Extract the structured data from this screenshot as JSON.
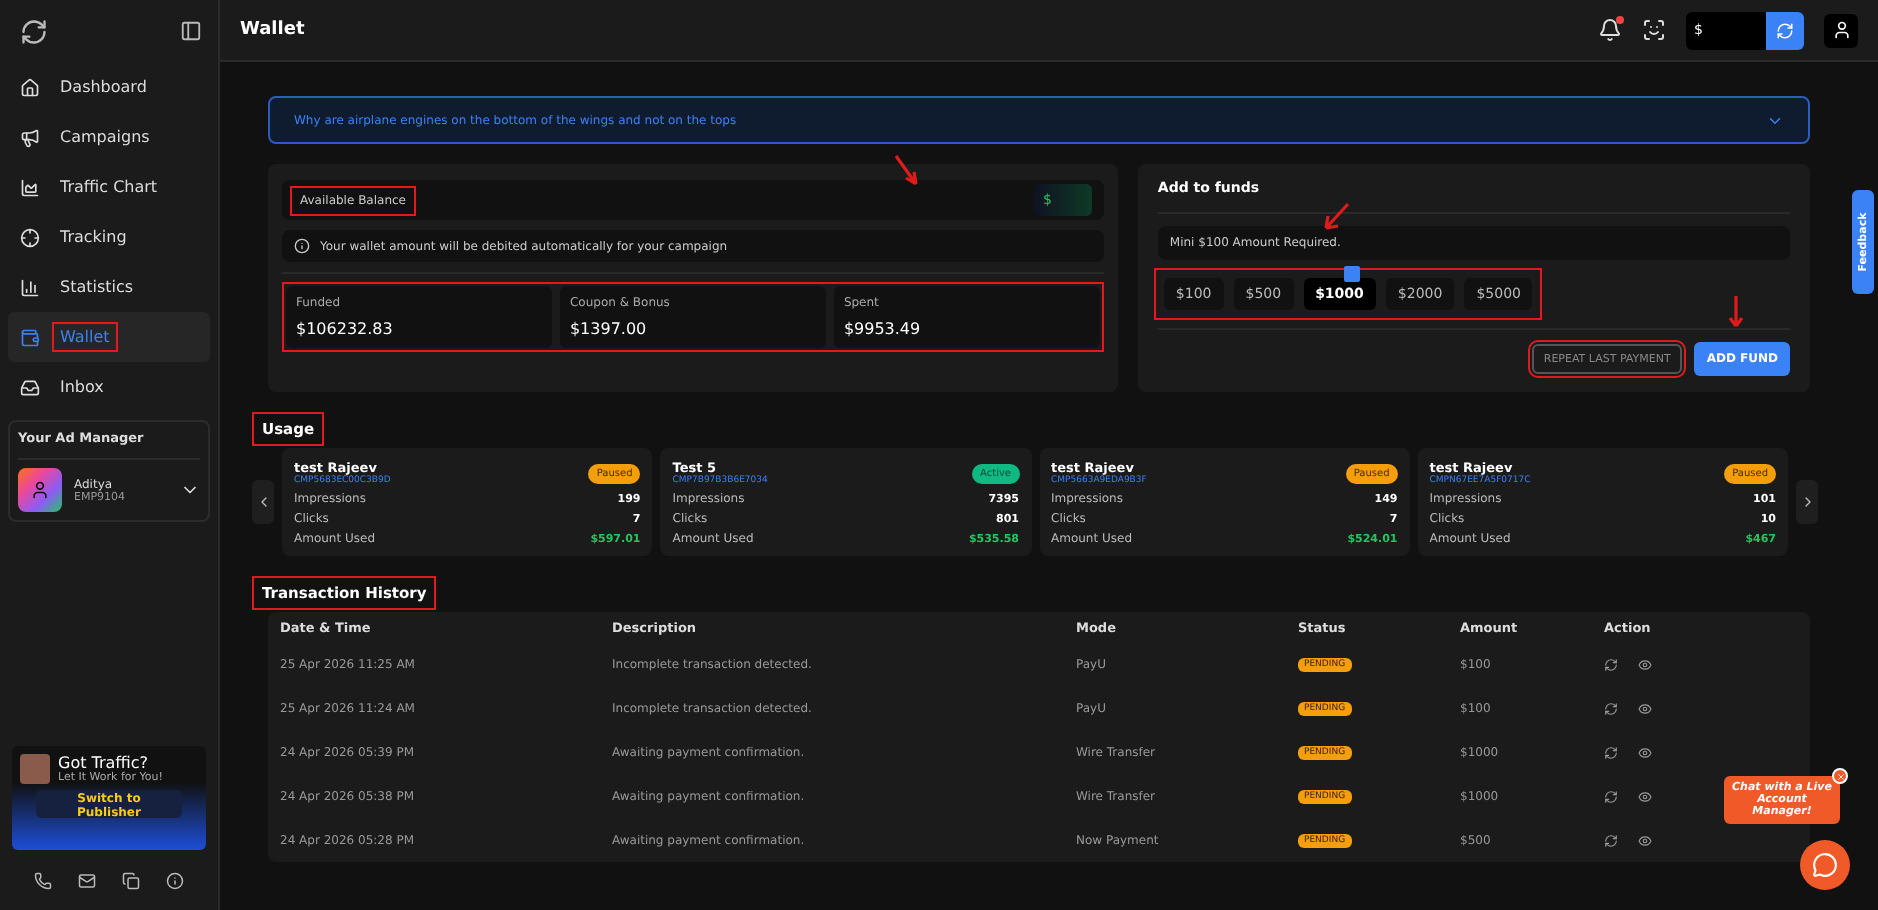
{
  "sidebar": {
    "items": [
      {
        "label": "Dashboard",
        "selected": false
      },
      {
        "label": "Campaigns",
        "selected": false
      },
      {
        "label": "Traffic Chart",
        "selected": false
      },
      {
        "label": "Tracking",
        "selected": false
      },
      {
        "label": "Statistics",
        "selected": false
      },
      {
        "label": "Wallet",
        "selected": true
      },
      {
        "label": "Inbox",
        "selected": false
      }
    ],
    "selected_highlighted": true,
    "manager": {
      "title": "Your Ad Manager",
      "name": "Aditya",
      "code": "EMP9104"
    },
    "promo": {
      "title": "Got Traffic?",
      "subtitle": "Let It Work for You!",
      "button": "Switch to Publisher"
    }
  },
  "header": {
    "title": "Wallet",
    "balance_symbol": "$",
    "notification_dot": true
  },
  "banner": {
    "text": "Why are airplane engines on the bottom of the wings and not on the tops"
  },
  "balance": {
    "label": "Available Balance",
    "value": "$",
    "highlighted": true,
    "pointer": true,
    "note": "Your wallet amount will be debited automatically for your campaign",
    "stats": [
      {
        "label": "Funded",
        "value": "$106232.83"
      },
      {
        "label": "Coupon & Bonus",
        "value": "$1397.00"
      },
      {
        "label": "Spent",
        "value": "$9953.49"
      }
    ],
    "stats_highlighted": true
  },
  "funds": {
    "title": "Add to funds",
    "hint": "Mini $100 Amount Required.",
    "hint_pointer": true,
    "amounts_highlighted": true,
    "amounts": [
      {
        "label": "$100",
        "selected": false,
        "badge": false
      },
      {
        "label": "$500",
        "selected": false,
        "badge": false
      },
      {
        "label": "$1000",
        "selected": true,
        "badge": true
      },
      {
        "label": "$2000",
        "selected": false,
        "badge": false
      },
      {
        "label": "$5000",
        "selected": false,
        "badge": false
      }
    ],
    "repeat_button": "REPEAT LAST PAYMENT",
    "repeat_highlighted": true,
    "add_button": "ADD FUND",
    "add_pointer": true
  },
  "usage": {
    "title": "Usage",
    "highlighted": true,
    "cards": [
      {
        "name": "test Rajeev",
        "code": "CMP5683EC00C3B9D",
        "status": "Paused",
        "kind": "paused",
        "stats": [
          {
            "label": "Impressions",
            "value": "199"
          },
          {
            "label": "Clicks",
            "value": "7"
          },
          {
            "label": "Amount Used",
            "value": "$597.01"
          }
        ]
      },
      {
        "name": "Test 5",
        "code": "CMP7B97B3B6E7034",
        "status": "Active",
        "kind": "active",
        "stats": [
          {
            "label": "Impressions",
            "value": "7395"
          },
          {
            "label": "Clicks",
            "value": "801"
          },
          {
            "label": "Amount Used",
            "value": "$535.58"
          }
        ]
      },
      {
        "name": "test Rajeev",
        "code": "CMP5663A9EDA9B3F",
        "status": "Paused",
        "kind": "paused",
        "stats": [
          {
            "label": "Impressions",
            "value": "149"
          },
          {
            "label": "Clicks",
            "value": "7"
          },
          {
            "label": "Amount Used",
            "value": "$524.01"
          }
        ]
      },
      {
        "name": "test Rajeev",
        "code": "CMPN67EE7A5F0717C",
        "status": "Paused",
        "kind": "paused",
        "stats": [
          {
            "label": "Impressions",
            "value": "101"
          },
          {
            "label": "Clicks",
            "value": "10"
          },
          {
            "label": "Amount Used",
            "value": "$467"
          }
        ]
      }
    ]
  },
  "transactions": {
    "title": "Transaction History",
    "highlighted": true,
    "columns": [
      "Date & Time",
      "Description",
      "Mode",
      "Status",
      "Amount",
      "Action"
    ],
    "rows": [
      {
        "date": "25 Apr 2026 11:25 AM",
        "description": "Incomplete transaction detected.",
        "mode": "PayU",
        "status": "PENDING",
        "amount": "$100"
      },
      {
        "date": "25 Apr 2026 11:24 AM",
        "description": "Incomplete transaction detected.",
        "mode": "PayU",
        "status": "PENDING",
        "amount": "$100"
      },
      {
        "date": "24 Apr 2026 05:39 PM",
        "description": "Awaiting payment confirmation.",
        "mode": "Wire Transfer",
        "status": "PENDING",
        "amount": "$1000"
      },
      {
        "date": "24 Apr 2026 05:38 PM",
        "description": "Awaiting payment confirmation.",
        "mode": "Wire Transfer",
        "status": "PENDING",
        "amount": "$1000"
      },
      {
        "date": "24 Apr 2026 05:28 PM",
        "description": "Awaiting payment confirmation.",
        "mode": "Now Payment",
        "status": "PENDING",
        "amount": "$500"
      }
    ]
  },
  "feedback": {
    "label": "Feedback"
  },
  "chat": {
    "text": "Chat with a Live Account Manager!"
  }
}
